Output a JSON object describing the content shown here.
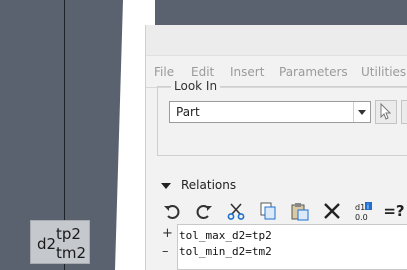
{
  "canvas": {
    "dimension": {
      "name": "d2",
      "upper": "tp2",
      "lower": "tm2"
    }
  },
  "menu": {
    "items": [
      "File",
      "Edit",
      "Insert",
      "Parameters",
      "Utilities"
    ]
  },
  "look_in": {
    "label": "Look In",
    "selected": "Part"
  },
  "relations": {
    "label": "Relations",
    "toolbar": [
      "undo-icon",
      "redo-icon",
      "cut-icon",
      "copy-icon",
      "paste-icon",
      "delete-icon",
      "insert-parameter-icon",
      "evaluate-icon"
    ],
    "evaluate_label": "=?",
    "lines": [
      "tol_max_d2=tp2",
      "tol_min_d2=tm2"
    ],
    "gutter": [
      "+",
      "–"
    ]
  }
}
